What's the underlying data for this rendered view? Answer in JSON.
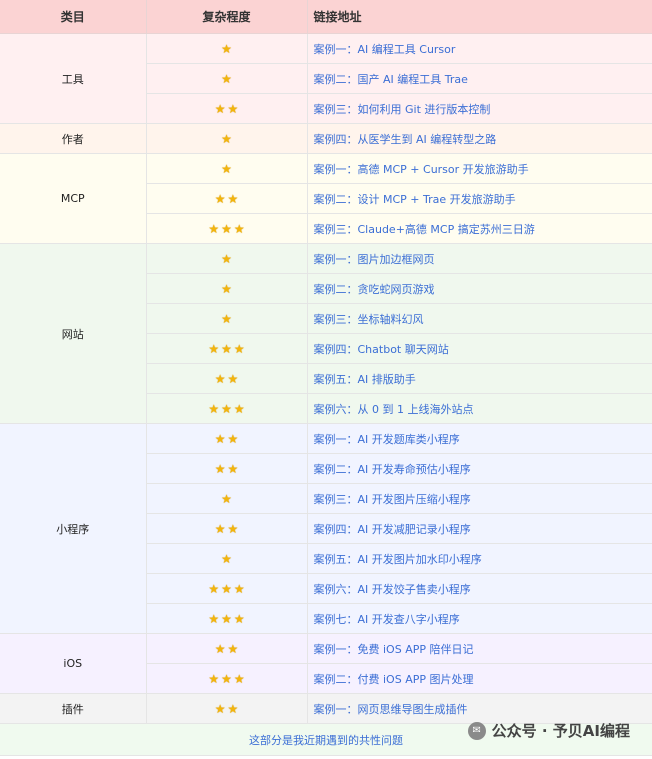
{
  "header": {
    "category": "类目",
    "complexity": "复杂程度",
    "link": "链接地址"
  },
  "groups": [
    {
      "category": "工具",
      "rows": [
        {
          "stars": 1,
          "link": "案例一：AI 编程工具 Cursor"
        },
        {
          "stars": 1,
          "link": "案例二：国产 AI 编程工具 Trae"
        },
        {
          "stars": 2,
          "link": "案例三：如何利用 Git 进行版本控制"
        }
      ]
    },
    {
      "category": "作者",
      "rows": [
        {
          "stars": 1,
          "link": "案例四：从医学生到 AI 编程转型之路"
        }
      ]
    },
    {
      "category": "MCP",
      "rows": [
        {
          "stars": 1,
          "link": "案例一：高德 MCP + Cursor 开发旅游助手"
        },
        {
          "stars": 2,
          "link": "案例二：设计 MCP + Trae 开发旅游助手"
        },
        {
          "stars": 3,
          "link": "案例三：Claude+高德 MCP 搞定苏州三日游"
        }
      ]
    },
    {
      "category": "网站",
      "rows": [
        {
          "stars": 1,
          "link": "案例一：图片加边框网页"
        },
        {
          "stars": 1,
          "link": "案例二：贪吃蛇网页游戏"
        },
        {
          "stars": 1,
          "link": "案例三：坐标轴料幻风"
        },
        {
          "stars": 3,
          "link": "案例四：Chatbot 聊天网站"
        },
        {
          "stars": 2,
          "link": "案例五：AI 排版助手"
        },
        {
          "stars": 3,
          "link": "案例六：从 0 到 1 上线海外站点"
        }
      ]
    },
    {
      "category": "小程序",
      "rows": [
        {
          "stars": 2,
          "link": "案例一：AI 开发题库类小程序"
        },
        {
          "stars": 2,
          "link": "案例二：AI 开发寿命预估小程序"
        },
        {
          "stars": 1,
          "link": "案例三：AI 开发图片压缩小程序"
        },
        {
          "stars": 2,
          "link": "案例四：AI 开发减肥记录小程序"
        },
        {
          "stars": 1,
          "link": "案例五：AI 开发图片加水印小程序"
        },
        {
          "stars": 3,
          "link": "案例六：AI 开发饺子售卖小程序"
        },
        {
          "stars": 3,
          "link": "案例七：AI 开发查八字小程序"
        }
      ]
    },
    {
      "category": "iOS",
      "rows": [
        {
          "stars": 2,
          "link": "案例一：免费 iOS APP 陪伴日记"
        },
        {
          "stars": 3,
          "link": "案例二：付费 iOS APP 图片处理"
        }
      ]
    },
    {
      "category": "插件",
      "rows": [
        {
          "stars": 2,
          "link": "案例一：网页思维导图生成插件"
        }
      ]
    }
  ],
  "footer": "这部分是我近期遇到的共性问题",
  "watermark": "公众号 · 予贝AI编程",
  "colors": {
    "header_bg": "#fbd3d3",
    "link": "#3b6ed5",
    "star": "#f2b50d"
  },
  "icons": {
    "star": "star-icon",
    "watermark": "wechat-icon"
  }
}
